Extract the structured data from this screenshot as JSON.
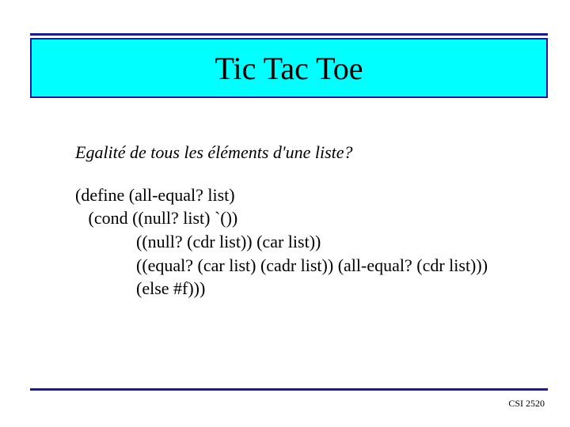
{
  "title": "Tic Tac Toe",
  "subtitle": "Egalité de tous les éléments d'une liste?",
  "code": {
    "l1": "(define (all-equal? list)",
    "l2": "   (cond ((null? list) `())",
    "l3": "              ((null? (cdr list)) (car list))",
    "l4": "              ((equal? (car list) (cadr list)) (all-equal? (cdr list)))",
    "l5": "              (else #f)))"
  },
  "footer": "CSI 2520",
  "colors": {
    "rule": "#1a1a9a",
    "title_bg": "#00ffff"
  }
}
